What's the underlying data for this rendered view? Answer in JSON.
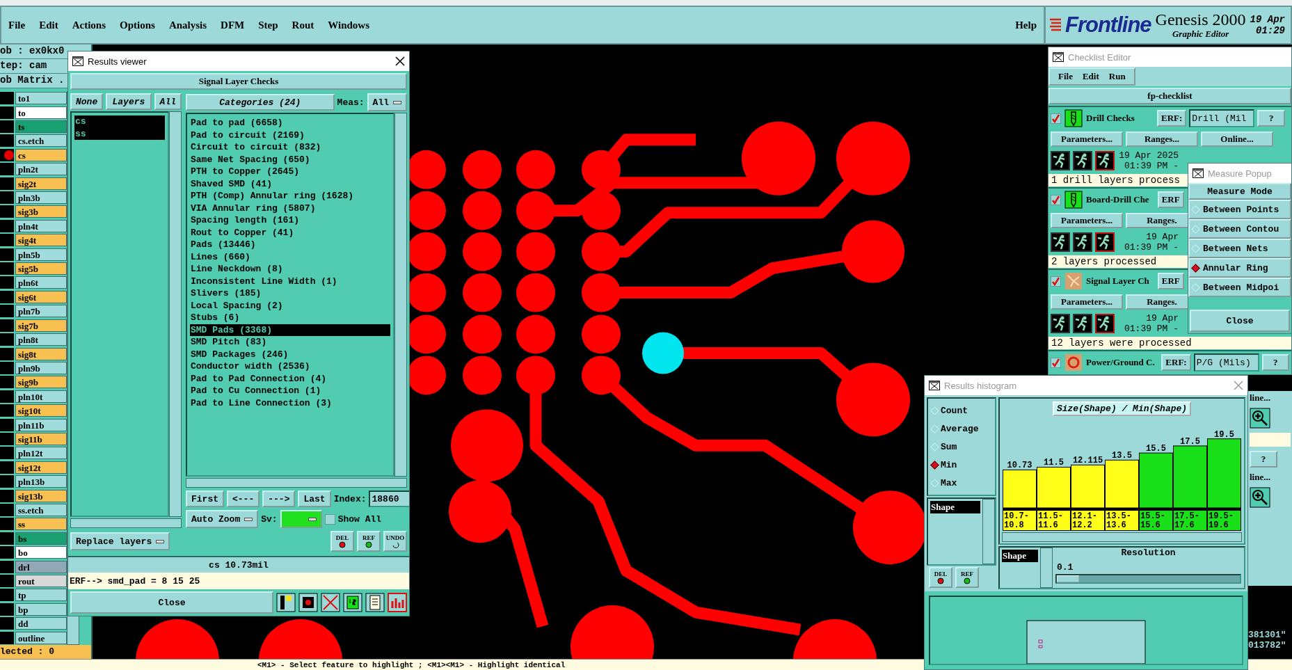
{
  "menu_bar": {
    "items": [
      "File",
      "Edit",
      "Actions",
      "Options",
      "Analysis",
      "DFM",
      "Step",
      "Rout",
      "Windows"
    ],
    "help": "Help"
  },
  "header": {
    "logo": "Frontline",
    "product": "Genesis 2000",
    "subtitle": "Graphic Editor",
    "date": "19 Apr",
    "time": "01:29"
  },
  "job_panel": {
    "job": "ob : ex0kx0",
    "step": "tep: cam",
    "matrix": "ob Matrix .",
    "selected_count": "lected : 0",
    "layers": [
      {
        "name": "to1",
        "color": "#a0dcdc",
        "work_layer": false
      },
      {
        "name": "to",
        "color": "#ffffff",
        "work_layer": false
      },
      {
        "name": "ts",
        "color": "#18a070",
        "work_layer": false
      },
      {
        "name": "cs.etch",
        "color": "#a0dcdc",
        "work_layer": false
      },
      {
        "name": "cs",
        "color": "#f8c050",
        "work_layer": true
      },
      {
        "name": "pln2t",
        "color": "#a0dcdc",
        "work_layer": false
      },
      {
        "name": "sig2t",
        "color": "#f8c050",
        "work_layer": false
      },
      {
        "name": "pln3b",
        "color": "#a0dcdc",
        "work_layer": false
      },
      {
        "name": "sig3b",
        "color": "#f8c050",
        "work_layer": false
      },
      {
        "name": "pln4t",
        "color": "#a0dcdc",
        "work_layer": false
      },
      {
        "name": "sig4t",
        "color": "#f8c050",
        "work_layer": false
      },
      {
        "name": "pln5b",
        "color": "#a0dcdc",
        "work_layer": false
      },
      {
        "name": "sig5b",
        "color": "#f8c050",
        "work_layer": false
      },
      {
        "name": "pln6t",
        "color": "#a0dcdc",
        "work_layer": false
      },
      {
        "name": "sig6t",
        "color": "#f8c050",
        "work_layer": false
      },
      {
        "name": "pln7b",
        "color": "#a0dcdc",
        "work_layer": false
      },
      {
        "name": "sig7b",
        "color": "#f8c050",
        "work_layer": false
      },
      {
        "name": "pln8t",
        "color": "#a0dcdc",
        "work_layer": false
      },
      {
        "name": "sig8t",
        "color": "#f8c050",
        "work_layer": false
      },
      {
        "name": "pln9b",
        "color": "#a0dcdc",
        "work_layer": false
      },
      {
        "name": "sig9b",
        "color": "#f8c050",
        "work_layer": false
      },
      {
        "name": "pln10t",
        "color": "#a0dcdc",
        "work_layer": false
      },
      {
        "name": "sig10t",
        "color": "#f8c050",
        "work_layer": false
      },
      {
        "name": "pln11b",
        "color": "#a0dcdc",
        "work_layer": false
      },
      {
        "name": "sig11b",
        "color": "#f8c050",
        "work_layer": false
      },
      {
        "name": "pln12t",
        "color": "#a0dcdc",
        "work_layer": false
      },
      {
        "name": "sig12t",
        "color": "#f8c050",
        "work_layer": false
      },
      {
        "name": "pln13b",
        "color": "#a0dcdc",
        "work_layer": false
      },
      {
        "name": "sig13b",
        "color": "#f8c050",
        "work_layer": false
      },
      {
        "name": "ss.etch",
        "color": "#a0dcdc",
        "work_layer": false
      },
      {
        "name": "ss",
        "color": "#f8c050",
        "work_layer": false
      },
      {
        "name": "bs",
        "color": "#18a070",
        "work_layer": false
      },
      {
        "name": "bo",
        "color": "#ffffff",
        "work_layer": false
      },
      {
        "name": "drl",
        "color": "#90a8b8",
        "work_layer": false
      },
      {
        "name": "rout",
        "color": "#d8d8d8",
        "work_layer": false
      },
      {
        "name": "tp",
        "color": "#a0dcdc",
        "work_layer": false
      },
      {
        "name": "bp",
        "color": "#a0dcdc",
        "work_layer": false
      },
      {
        "name": "dd",
        "color": "#a0dcdc",
        "work_layer": false
      },
      {
        "name": "outline",
        "color": "#a0dcdc",
        "work_layer": false
      }
    ]
  },
  "results_viewer": {
    "title": "Results viewer",
    "heading": "Signal Layer Checks",
    "layer_buttons": [
      "None",
      "Layers",
      "All"
    ],
    "layers": [
      {
        "label": "cs",
        "selected": true
      },
      {
        "label": "ss",
        "selected": true
      }
    ],
    "replace": "Replace layers",
    "categories_button": "Categories (24)",
    "meas_label": "Meas:",
    "meas_value": "All",
    "categories": [
      {
        "label": "Pad to pad (6658)",
        "selected": false
      },
      {
        "label": "Pad to circuit (2169)",
        "selected": false
      },
      {
        "label": "Circuit to circuit (832)",
        "selected": false
      },
      {
        "label": "Same Net Spacing (650)",
        "selected": false
      },
      {
        "label": "PTH to Copper (2645)",
        "selected": false
      },
      {
        "label": "Shaved SMD (41)",
        "selected": false
      },
      {
        "label": "PTH (Comp) Annular ring (1628)",
        "selected": false
      },
      {
        "label": "VIA Annular ring (5807)",
        "selected": false
      },
      {
        "label": "Spacing length (161)",
        "selected": false
      },
      {
        "label": "Rout to Copper (41)",
        "selected": false
      },
      {
        "label": "Pads (13446)",
        "selected": false
      },
      {
        "label": "Lines (660)",
        "selected": false
      },
      {
        "label": "Line Neckdown (8)",
        "selected": false
      },
      {
        "label": "Inconsistent Line Width (1)",
        "selected": false
      },
      {
        "label": "Slivers (185)",
        "selected": false
      },
      {
        "label": "Local Spacing (2)",
        "selected": false
      },
      {
        "label": "Stubs (6)",
        "selected": false
      },
      {
        "label": "SMD Pads (3368)",
        "selected": true
      },
      {
        "label": "SMD Pitch (83)",
        "selected": false
      },
      {
        "label": "SMD Packages (246)",
        "selected": false
      },
      {
        "label": "Conductor width (2536)",
        "selected": false
      },
      {
        "label": "Pad to Pad Connection (4)",
        "selected": false
      },
      {
        "label": "Pad to Cu Connection (1)",
        "selected": false
      },
      {
        "label": "Pad to Line Connection (3)",
        "selected": false
      }
    ],
    "nav": [
      "First",
      "<---",
      "--->",
      "Last"
    ],
    "index_label": "Index:",
    "index_value": "18860",
    "zoom": "Auto Zoom",
    "sv_label": "Sv:",
    "show_all": {
      "label": "Show All",
      "checked": false
    },
    "actions": [
      "DEL",
      "REF",
      "UNDO"
    ],
    "measurement": "cs 10.73mil",
    "erf": "ERF--> smd_pad = 8 15 25",
    "close": "Close"
  },
  "checklist_editor": {
    "title": "Checklist Editor",
    "menu": [
      "File",
      "Edit",
      "Run"
    ],
    "checklist": "fp-checklist",
    "checks": [
      {
        "kind": "drill",
        "checked": true,
        "name": "Drill Checks",
        "erf": "ERF:",
        "erf_value": "Drill (Mil",
        "help": "?",
        "buttons": [
          "Parameters...",
          "Ranges...",
          "Online..."
        ],
        "date": "19 Apr 2025",
        "time": "01:39 PM -",
        "status": "1 drill layers process"
      },
      {
        "kind": "drill",
        "checked": true,
        "name": "Board-Drill Che",
        "erf": "ERF",
        "buttons": [
          "Parameters...",
          "Ranges."
        ],
        "date": "19 Apr",
        "time": "01:39 PM -",
        "status": "2 layers processed"
      },
      {
        "kind": "signal",
        "checked": true,
        "name": "Signal Layer Ch",
        "erf": "ERF",
        "buttons": [
          "Parameters...",
          "Ranges."
        ],
        "date": "19 Apr",
        "time": "01:39 PM -",
        "status": "12 layers were processed"
      },
      {
        "kind": "power",
        "checked": true,
        "name": "Power/Ground C.",
        "erf": "ERF:",
        "erf_value": "P/G (Mils)",
        "help": "?"
      }
    ]
  },
  "measure_popup": {
    "title": "Measure Popup",
    "heading": "Measure Mode",
    "modes": [
      {
        "label": "Between Points",
        "selected": false
      },
      {
        "label": "Between Contou",
        "selected": false
      },
      {
        "label": "Between Nets",
        "selected": false
      },
      {
        "label": "Annular Ring",
        "selected": true
      },
      {
        "label": "Between Midpoi",
        "selected": false
      }
    ],
    "close": "Close"
  },
  "results_histogram": {
    "title": "Results histogram",
    "modes": [
      {
        "label": "Count",
        "selected": false
      },
      {
        "label": "Average",
        "selected": false
      },
      {
        "label": "Sum",
        "selected": false
      },
      {
        "label": "Min",
        "selected": true
      },
      {
        "label": "Max",
        "selected": false
      }
    ],
    "list": [
      {
        "label": "Shape",
        "selected": true
      }
    ],
    "actions": [
      "DEL",
      "REF"
    ],
    "field_list": [
      {
        "label": "Shape",
        "selected": true
      }
    ],
    "resolution_label": "Resolution",
    "resolution_value": "0.1",
    "resolution": {
      "level": 0.12
    },
    "chart_data": {
      "type": "bar",
      "title": "Size(Shape) / Min(Shape)",
      "categories": [
        "10.7-10.8",
        "11.5-11.6",
        "12.1-12.2",
        "13.5-13.6",
        "15.5-15.6",
        "17.5-17.6",
        "19.5-19.6"
      ],
      "stacked": true,
      "data_labels": true,
      "series": [
        {
          "color": "#ffff1a",
          "values": [
            10.73,
            11.5,
            12.115,
            13.5,
            null,
            null,
            null
          ]
        },
        {
          "color": "#1ae01a",
          "values": [
            null,
            null,
            null,
            null,
            15.5,
            17.5,
            19.5
          ]
        }
      ]
    }
  },
  "checklist_peek": {
    "items": [
      "line...",
      "line..."
    ],
    "help": "?",
    "coords": [
      "381301\"",
      "013782\""
    ]
  },
  "status_bar": {
    "hint": "<M1> - Select feature to highlight ; <M1><M1> - Highlight identical"
  }
}
